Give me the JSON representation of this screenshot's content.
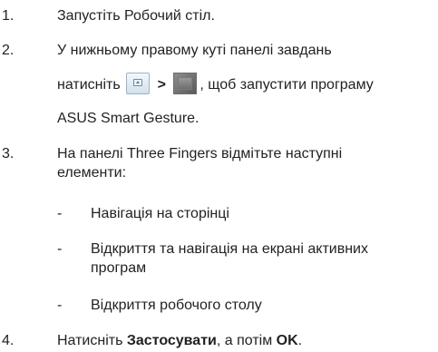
{
  "steps": [
    {
      "number": "1.",
      "text": "Запустіть Робочий стіл."
    },
    {
      "number": "2.",
      "line1": "У нижньому правому куті панелі завдань",
      "line2_before": "натисніть",
      "line2_sep": ">",
      "line2_after": ", щоб запустити програму",
      "line3": "ASUS Smart Gesture.",
      "icons": [
        "show-hidden-icons-arrow-icon",
        "smart-gesture-app-icon"
      ]
    },
    {
      "number": "3.",
      "line1": "На панелі Three Fingers відмітьте наступні",
      "line2": "елементи:",
      "items": [
        {
          "dash": "-",
          "lines": [
            "Навігація на сторінці"
          ]
        },
        {
          "dash": "-",
          "lines": [
            "Відкриття та навігація на екрані активних",
            "програм"
          ]
        },
        {
          "dash": "-",
          "lines": [
            "Відкриття робочого столу"
          ]
        }
      ]
    },
    {
      "number": "4.",
      "before": "Натисніть ",
      "bold1": "Застосувати",
      "middle": ", а потім ",
      "bold2": "OK",
      "after": "."
    }
  ]
}
